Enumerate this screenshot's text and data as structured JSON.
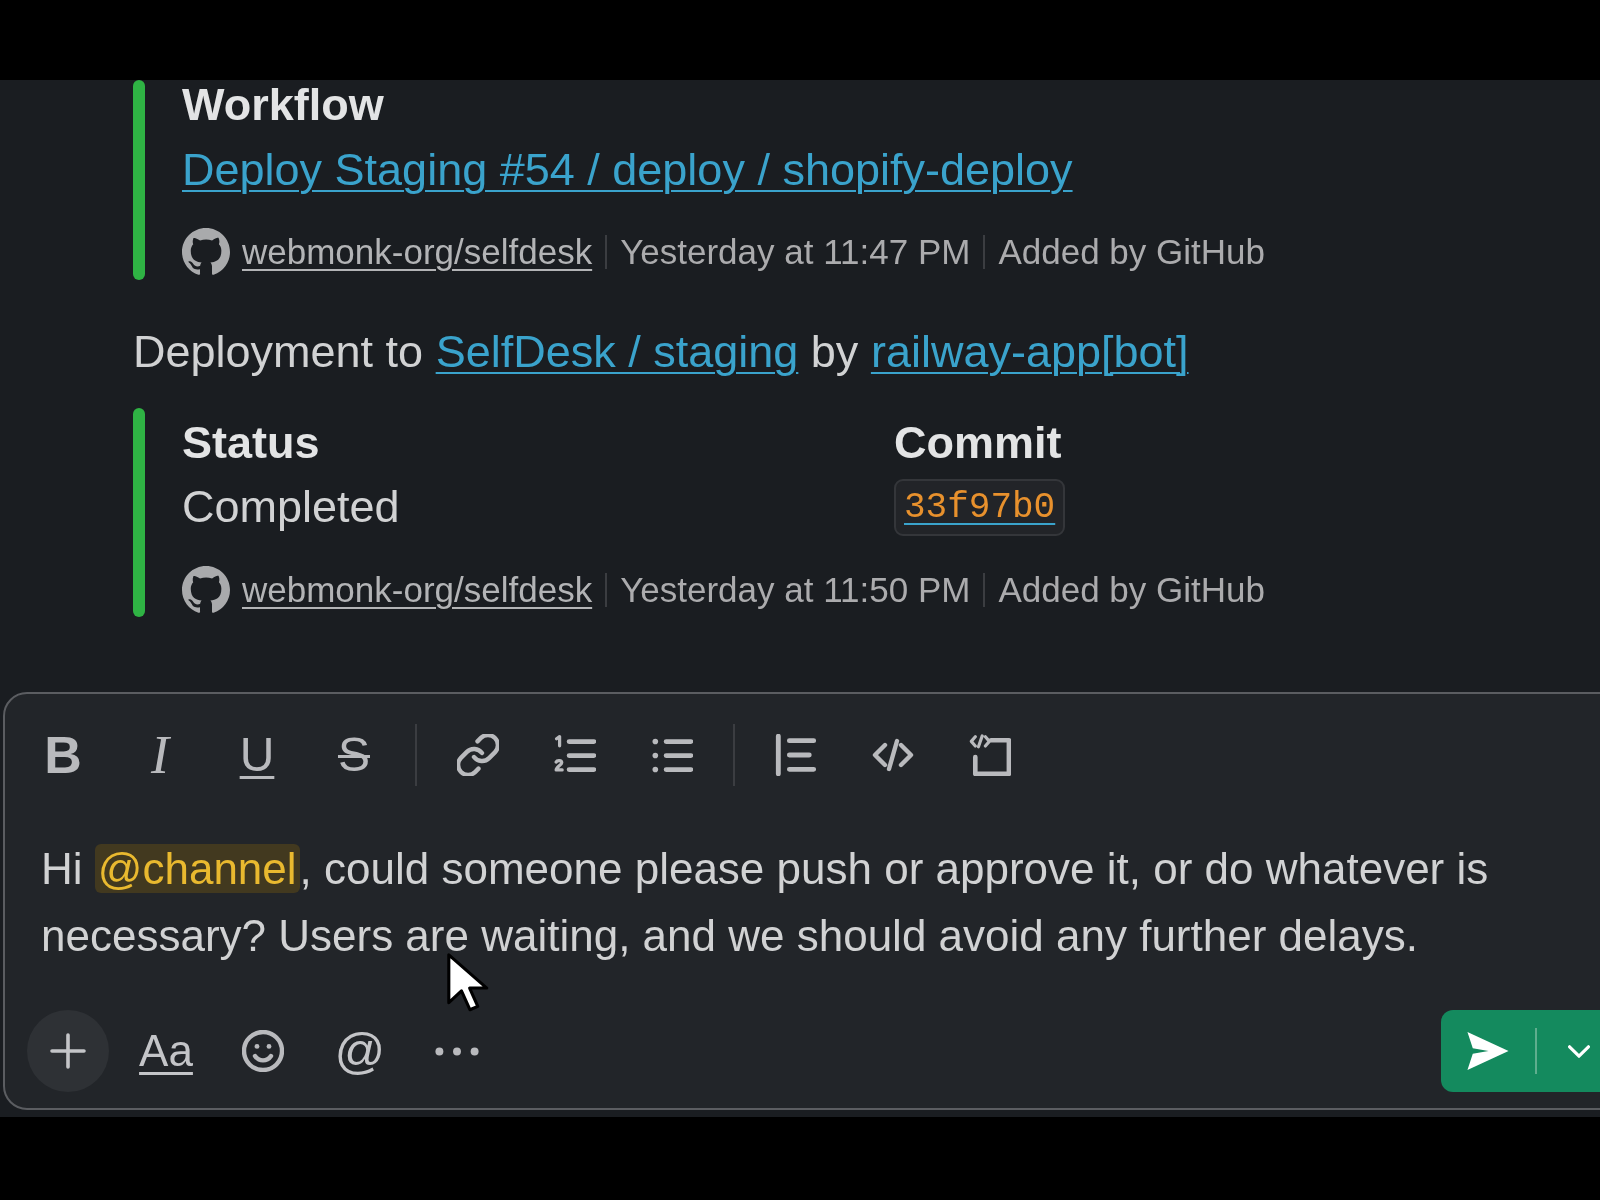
{
  "messages": [
    {
      "kind": "attachment",
      "title": "Workflow",
      "link": "Deploy Staging #54 / deploy / shopify-deploy",
      "footer": {
        "repo": "webmonk-org/selfdesk",
        "time": "Yesterday at 11:47 PM",
        "source": "Added by GitHub"
      }
    },
    {
      "kind": "text",
      "parts": [
        {
          "kind": "plain",
          "text": "Deployment to "
        },
        {
          "kind": "link",
          "text": "SelfDesk / staging"
        },
        {
          "kind": "plain",
          "text": " by "
        },
        {
          "kind": "link",
          "text": "railway-app[bot]"
        }
      ]
    },
    {
      "kind": "field_attachment",
      "fields": [
        {
          "kind": "plain",
          "label": "Status",
          "value": "Completed"
        },
        {
          "kind": "code",
          "label": "Commit",
          "value": "33f97b0"
        }
      ],
      "footer": {
        "repo": "webmonk-org/selfdesk",
        "time": "Yesterday at 11:50 PM",
        "source": "Added by GitHub"
      }
    }
  ],
  "composer": {
    "toolbar": [
      {
        "kind": "bold",
        "glyph": "B"
      },
      {
        "kind": "italic",
        "glyph": "I"
      },
      {
        "kind": "underline",
        "glyph": "U"
      },
      {
        "kind": "strike",
        "glyph": "S"
      },
      {
        "kind": "separator"
      },
      {
        "kind": "link"
      },
      {
        "kind": "ordered_list"
      },
      {
        "kind": "bullet_list"
      },
      {
        "kind": "separator"
      },
      {
        "kind": "quote"
      },
      {
        "kind": "code"
      },
      {
        "kind": "code_block"
      }
    ],
    "message": [
      {
        "kind": "plain",
        "text": "Hi "
      },
      {
        "kind": "mention",
        "text": "@channel"
      },
      {
        "kind": "plain",
        "text": ", could someone please push or approve it, or do whatever is necessary? Users are waiting, and we should avoid any further delays."
      }
    ],
    "actions": [
      {
        "kind": "add"
      },
      {
        "kind": "format",
        "glyph": "Aa"
      },
      {
        "kind": "emoji"
      },
      {
        "kind": "mention",
        "glyph": "@"
      },
      {
        "kind": "more"
      }
    ]
  }
}
